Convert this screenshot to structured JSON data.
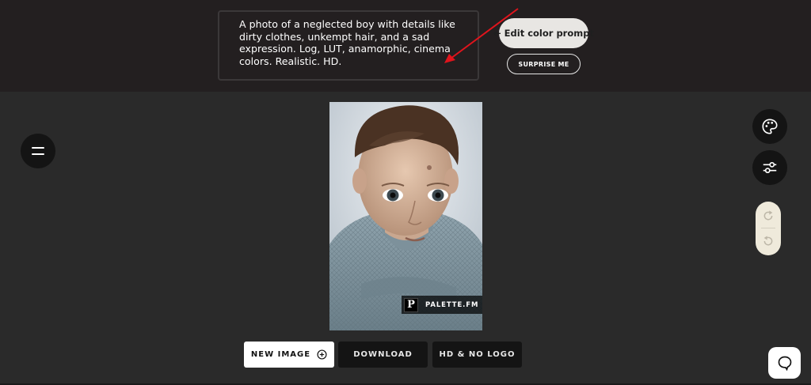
{
  "prompt": {
    "text": "A photo of a neglected boy with details like dirty clothes, unkempt hair, and a sad expression. Log, LUT, anamorphic, cinema colors. Realistic. HD."
  },
  "header": {
    "edit_button": "← Edit color prompt",
    "surprise_button": "SURPRISE ME"
  },
  "image": {
    "watermark_letter": "P",
    "watermark_text": "PALETTE.FM"
  },
  "actions": {
    "new_image": "NEW IMAGE",
    "download": "DOWNLOAD",
    "hd_no_logo": "HD & NO LOGO"
  },
  "icons": {
    "menu": "hamburger-menu-icon",
    "palette": "palette-icon",
    "settings": "sliders-icon",
    "redo": "redo-icon",
    "undo": "undo-icon",
    "new": "plus-circle-icon",
    "chat": "chat-bubble-icon",
    "annotation": "red-arrow-annotation"
  },
  "colors": {
    "annotation_arrow": "#e0141c",
    "topbar": "#231f20",
    "canvas": "#2a2a2a",
    "undo_pill": "#efeadb"
  }
}
